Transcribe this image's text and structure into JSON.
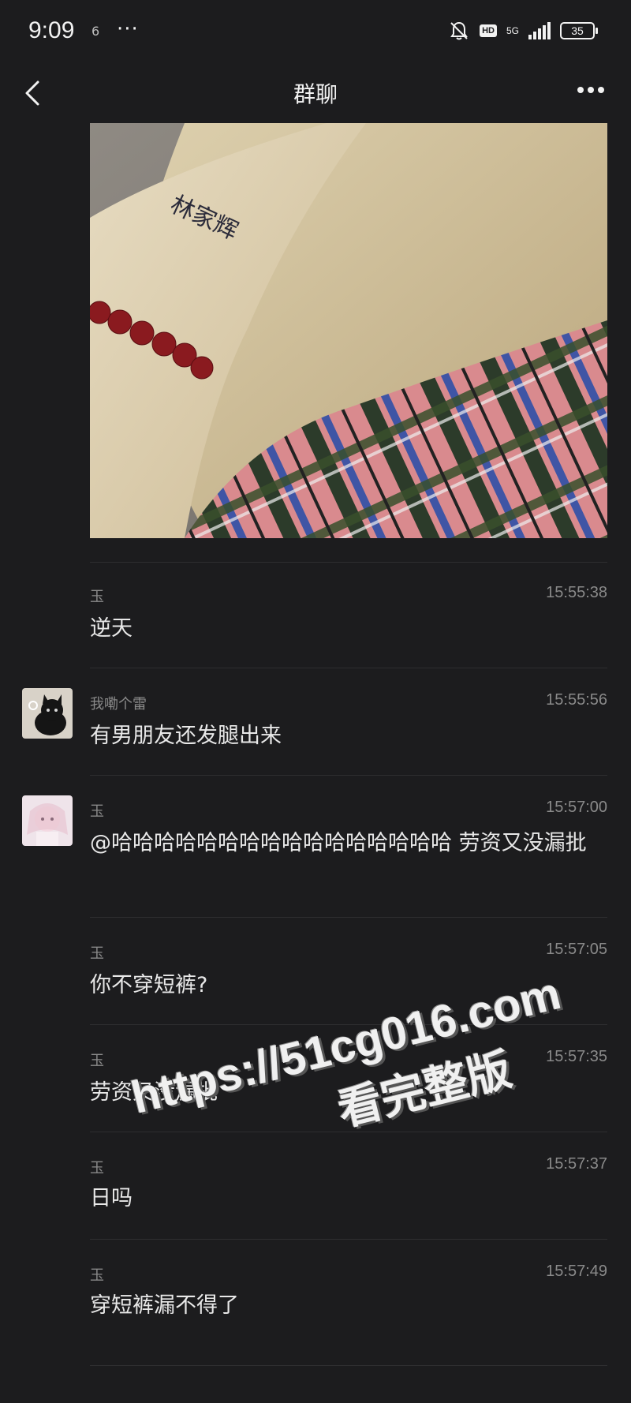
{
  "status_bar": {
    "time": "9:09",
    "small_icon": "6",
    "dots": "···",
    "hd": "HD",
    "network": "5G",
    "battery": "35"
  },
  "header": {
    "title": "群聊"
  },
  "messages": [
    {
      "sender": "玉",
      "time": "15:55:38",
      "text": "逆天",
      "has_avatar": false
    },
    {
      "sender": "我嘞个雷",
      "time": "15:55:56",
      "text": "有男朋友还发腿出来",
      "has_avatar": true,
      "avatar": "black-cat"
    },
    {
      "sender": "玉",
      "time": "15:57:00",
      "text": "@哈哈哈哈哈哈哈哈哈哈哈哈哈哈哈哈 劳资又没漏批",
      "has_avatar": true,
      "avatar": "pink-anime"
    },
    {
      "sender": "玉",
      "time": "15:57:05",
      "text": "你不穿短裤?",
      "has_avatar": false
    },
    {
      "sender": "玉",
      "time": "15:57:35",
      "text": "劳资又没漏批",
      "has_avatar": false
    },
    {
      "sender": "玉",
      "time": "15:57:37",
      "text": "日吗",
      "has_avatar": false
    },
    {
      "sender": "玉",
      "time": "15:57:49",
      "text": "穿短裤漏不得了",
      "has_avatar": false
    }
  ],
  "watermark": {
    "url": "https://51cg016.com",
    "sub": "看完整版"
  },
  "photo": {
    "tattoo_text": "林家辉"
  },
  "icons": [
    "back-arrow-icon",
    "more-dots-icon",
    "mute-bell-icon",
    "signal-icon",
    "battery-icon"
  ]
}
